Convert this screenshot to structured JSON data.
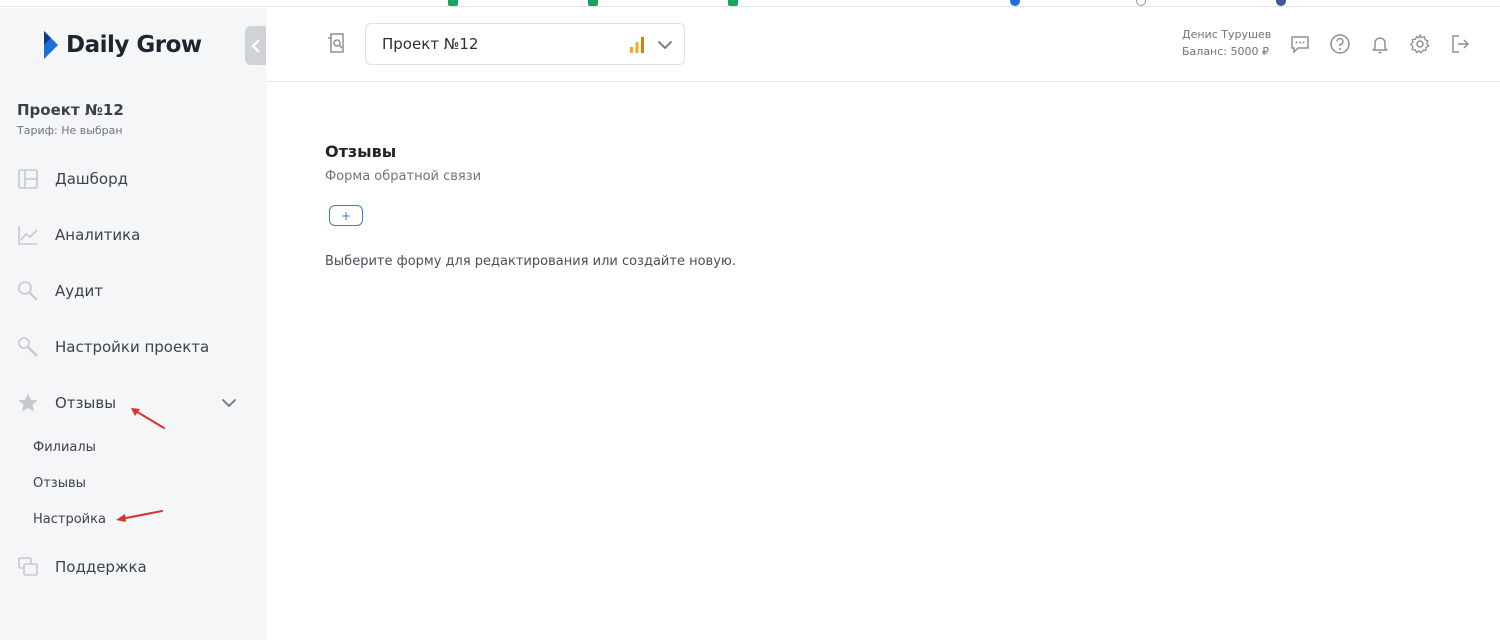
{
  "app": {
    "name": "Daily Grow",
    "accent_color": "#1e6fd9"
  },
  "sidebar": {
    "project_title": "Проект №12",
    "project_tariff": "Тариф: Не выбран",
    "items": [
      {
        "label": "Дашборд",
        "icon": "dashboard-icon"
      },
      {
        "label": "Аналитика",
        "icon": "chart-line-icon"
      },
      {
        "label": "Аудит",
        "icon": "search-icon"
      },
      {
        "label": "Настройки проекта",
        "icon": "wrench-icon"
      },
      {
        "label": "Отзывы",
        "icon": "star-icon",
        "expanded": true
      },
      {
        "label": "Поддержка",
        "icon": "chat-icon"
      }
    ],
    "subitems": [
      {
        "label": "Филиалы"
      },
      {
        "label": "Отзывы"
      },
      {
        "label": "Настройка"
      }
    ]
  },
  "header": {
    "project_select_value": "Проект №12",
    "user_name": "Денис Турушев",
    "balance": "Баланс: 5000 ₽"
  },
  "main": {
    "title": "Отзывы",
    "subtitle": "Форма обратной связи",
    "add_label": "+",
    "hint": "Выберите форму для редактирования или создайте новую."
  }
}
